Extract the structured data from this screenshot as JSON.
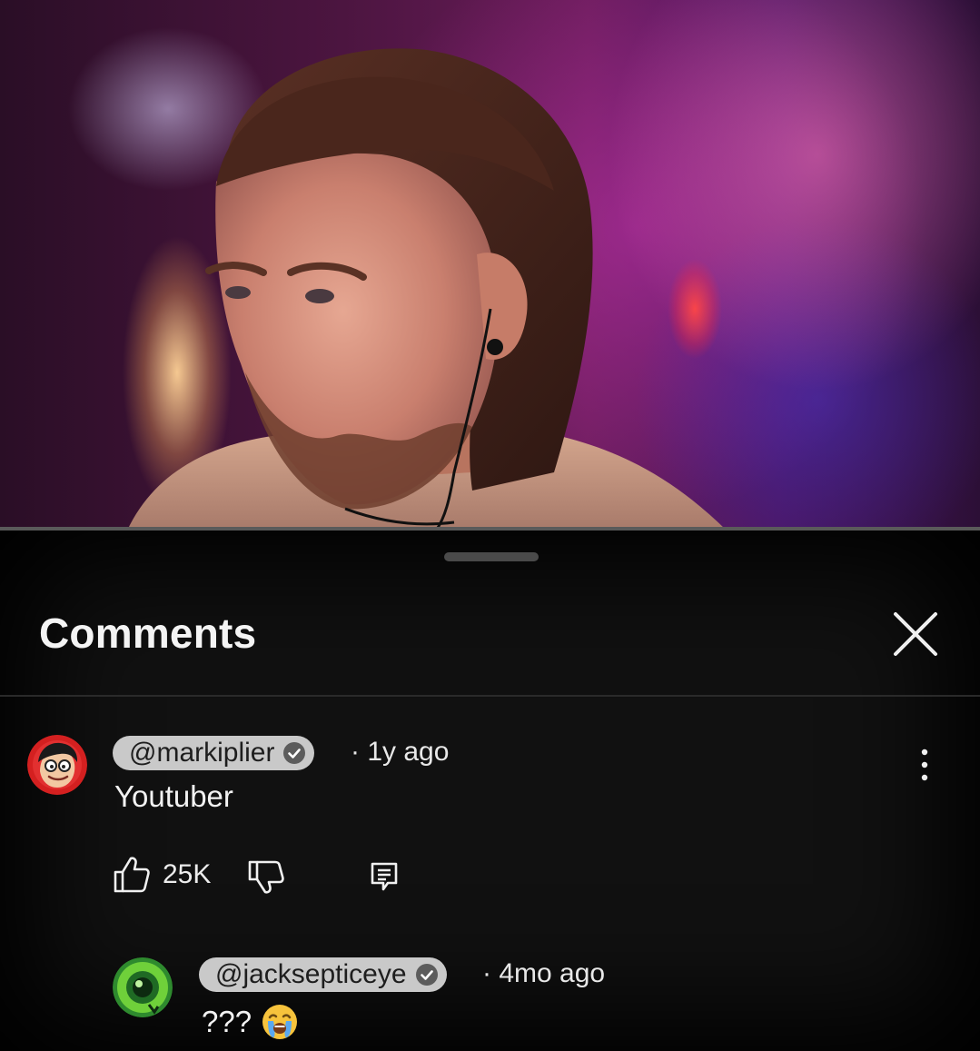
{
  "comments_panel": {
    "title": "Comments",
    "close_icon": "close-icon"
  },
  "comments": [
    {
      "handle": "@markiplier",
      "verified": true,
      "time": "· 1y ago",
      "text": "Youtuber",
      "likes": "25K"
    },
    {
      "handle": "@jacksepticeye",
      "verified": true,
      "time": "· 4mo ago",
      "text": "???",
      "emoji": "loudly-crying-face-icon"
    }
  ],
  "colors": {
    "sheet_background": "#111111",
    "handle_pill": "#c9c9c9",
    "text": "#f1f1f1"
  }
}
